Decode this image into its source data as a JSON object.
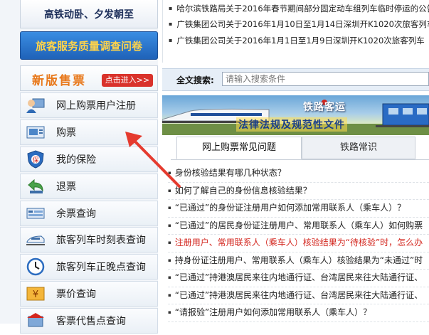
{
  "left": {
    "banner_top": "高铁动卧、夕发朝至",
    "banner_survey": "旅客服务质量调查问卷",
    "new_sale": {
      "title": "新版售票",
      "enter_button": "点击进入>>"
    },
    "menu": [
      {
        "label": "网上购票用户注册",
        "icon": "user-register-icon"
      },
      {
        "label": "购票",
        "icon": "ticket-purchase-icon"
      },
      {
        "label": "我的保险",
        "icon": "insurance-shield-icon"
      },
      {
        "label": "退票",
        "icon": "refund-arrow-icon"
      },
      {
        "label": "余票查询",
        "icon": "remaining-ticket-icon"
      },
      {
        "label": "旅客列车时刻表查询",
        "icon": "train-timetable-icon"
      },
      {
        "label": "旅客列车正晚点查询",
        "icon": "clock-icon"
      },
      {
        "label": "票价查询",
        "icon": "price-yen-icon"
      },
      {
        "label": "客票代售点查询",
        "icon": "agency-icon"
      }
    ]
  },
  "news": [
    "哈尔滨铁路局关于2016年春节期间部分固定动车组列车临时停运的公告",
    "广铁集团公司关于2016年1月10日至1月14日深圳开K1020次旅客列车",
    "广铁集团公司关于2016年1月1日至1月9日深圳开K1020次旅客列车"
  ],
  "search": {
    "label": "全文搜索:",
    "placeholder": "请输入搜索条件"
  },
  "rail_banner": {
    "line1": "铁路客运",
    "line2": "法律法规及规范性文件"
  },
  "tabs": {
    "active": "网上购票常见问题",
    "inactive": "铁路常识"
  },
  "faq": [
    {
      "text": "身份核验结果有哪几种状态？",
      "red": false
    },
    {
      "text": "如何了解自己的身份信息核验结果？",
      "red": false
    },
    {
      "text": "“已通过”的身份证注册用户如何添加常用联系人（乘车人）？",
      "red": false
    },
    {
      "text": "“已通过”的居民身份证注册用户、常用联系人（乘车人）如何购票",
      "red": false
    },
    {
      "text": "注册用户、常用联系人（乘车人）核验结果为“待核验”时，怎么办",
      "red": true
    },
    {
      "text": "持身份证注册用户、常用联系人（乘车人）核验结果为“未通过”时",
      "red": false
    },
    {
      "text": "“已通过”持港澳居民来往内地通行证、台湾居民来往大陆通行证、",
      "red": false
    },
    {
      "text": "“已通过”持港澳居民来往内地通行证、台湾居民来往大陆通行证、",
      "red": false
    },
    {
      "text": "“请报验”注册用户如何添加常用联系人（乘车人）？",
      "red": false
    }
  ],
  "colors": {
    "accent_orange": "#e8791c",
    "enter_red": "#d9322b",
    "faq_red": "#d3261e",
    "arrow_red": "#e53b2f"
  }
}
